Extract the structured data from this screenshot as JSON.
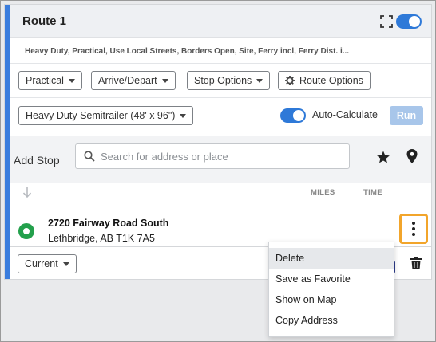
{
  "route": {
    "title": "Route 1",
    "summary": "Heavy Duty, Practical, Use Local Streets, Borders Open, Site, Ferry incl, Ferry Dist. i..."
  },
  "toolbar": {
    "practical_label": "Practical",
    "arrive_depart_label": "Arrive/Depart",
    "stop_options_label": "Stop Options",
    "route_options_label": "Route Options"
  },
  "vehicle": {
    "profile_label": "Heavy Duty Semitrailer (48' x 96\")",
    "auto_calculate_label": "Auto-Calculate",
    "run_label": "Run"
  },
  "add_stop": {
    "label": "Add Stop",
    "search_placeholder": "Search for address or place"
  },
  "columns": {
    "miles": "MILES",
    "time": "TIME"
  },
  "stops": [
    {
      "name": "2720 Fairway Road South",
      "address": "Lethbridge, AB T1K 7A5"
    }
  ],
  "footer": {
    "current_label": "Current"
  },
  "context_menu": {
    "items": [
      "Delete",
      "Save as Favorite",
      "Show on Map",
      "Copy Address"
    ],
    "active": "Delete"
  },
  "colors": {
    "accent": "#3b7ddd",
    "toggle_on": "#2e79d8",
    "stop_marker": "#23a04c",
    "highlight": "#f2a52b",
    "run_disabled": "#a8c6ea"
  },
  "icons": [
    "expand-icon",
    "search-icon",
    "star-icon",
    "map-pin-icon",
    "sort-arrow-icon",
    "more-vertical-icon",
    "trash-icon",
    "gear-icon",
    "caret-down-icon"
  ]
}
